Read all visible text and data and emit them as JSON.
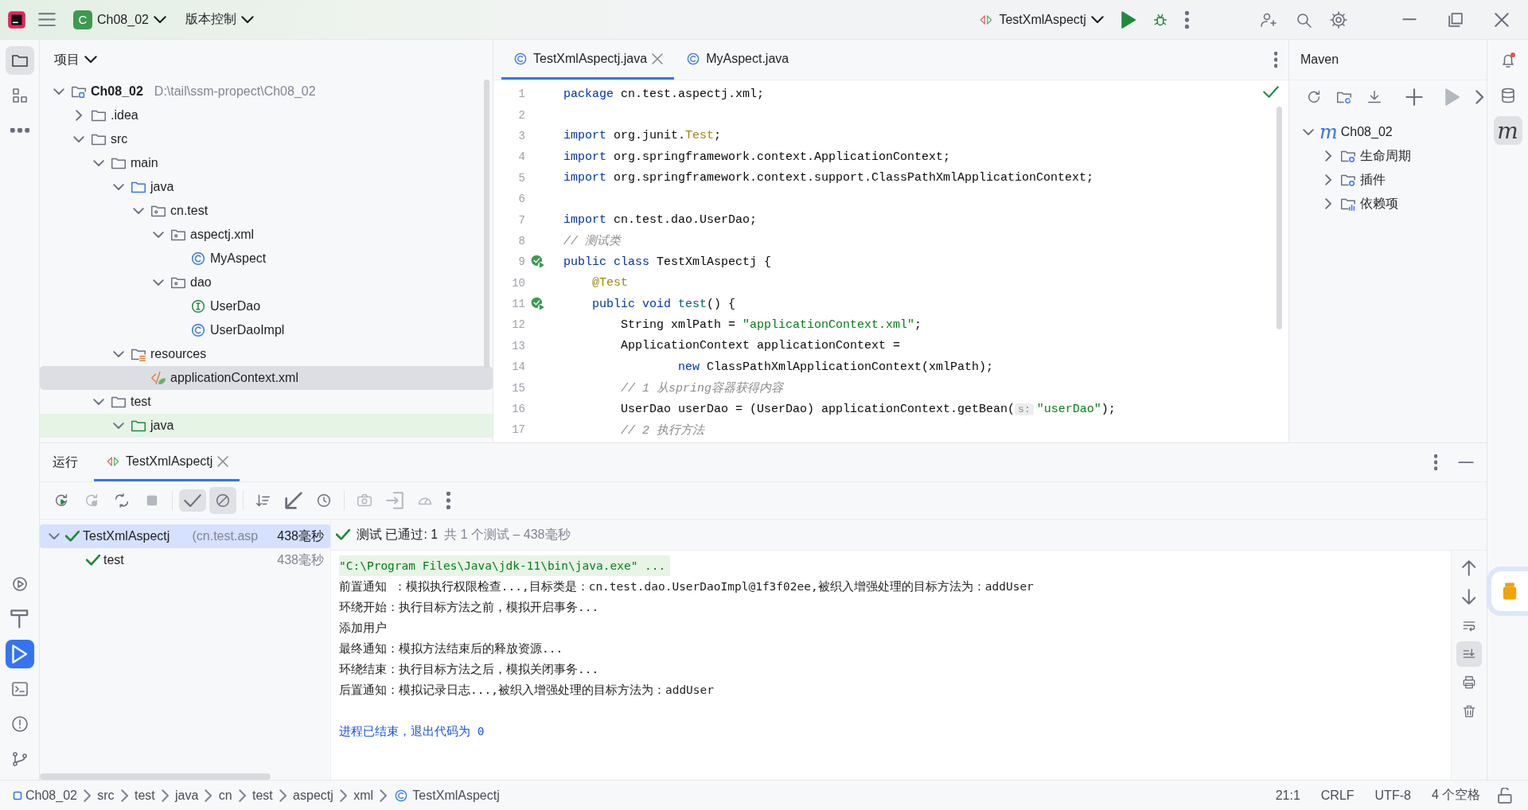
{
  "title_bar": {
    "project_badge": "C",
    "project": "Ch08_02",
    "vcs": "版本控制",
    "run_config": "TestXmlAspectj"
  },
  "left_tools": {
    "top": [
      {
        "kind": "project",
        "selected": true
      },
      {
        "kind": "structure",
        "selected": false
      },
      {
        "kind": "more",
        "selected": false
      }
    ],
    "bottom": [
      {
        "kind": "services",
        "selected": false
      },
      {
        "kind": "build",
        "selected": false
      },
      {
        "kind": "run",
        "selected": true
      },
      {
        "kind": "terminal",
        "selected": false
      },
      {
        "kind": "problems",
        "selected": false
      },
      {
        "kind": "git",
        "selected": false
      }
    ]
  },
  "project_panel": {
    "title": "项目",
    "tree": [
      {
        "label": "Ch08_02",
        "path": "D:\\tail\\ssm-propect\\Ch08_02",
        "kind": "module",
        "expanded": true,
        "selected": false,
        "children": [
          {
            "label": ".idea",
            "kind": "folder",
            "expanded": false,
            "selected": false
          },
          {
            "label": "src",
            "kind": "folder",
            "expanded": true,
            "selected": false,
            "children": [
              {
                "label": "main",
                "kind": "folder",
                "expanded": true,
                "selected": false,
                "children": [
                  {
                    "label": "java",
                    "kind": "source",
                    "expanded": true,
                    "selected": false,
                    "children": [
                      {
                        "label": "cn.test",
                        "kind": "package",
                        "expanded": true,
                        "selected": false,
                        "children": [
                          {
                            "label": "aspectj.xml",
                            "kind": "package",
                            "expanded": true,
                            "selected": false,
                            "children": [
                              {
                                "label": "MyAspect",
                                "kind": "class",
                                "selected": false
                              }
                            ]
                          },
                          {
                            "label": "dao",
                            "kind": "package",
                            "expanded": true,
                            "selected": false,
                            "children": [
                              {
                                "label": "UserDao",
                                "kind": "interface",
                                "selected": false
                              },
                              {
                                "label": "UserDaoImpl",
                                "kind": "class",
                                "selected": false
                              }
                            ]
                          }
                        ]
                      }
                    ]
                  },
                  {
                    "label": "resources",
                    "kind": "resources",
                    "expanded": true,
                    "selected": false,
                    "children": [
                      {
                        "label": "applicationContext.xml",
                        "kind": "xml",
                        "selected": true
                      }
                    ]
                  }
                ]
              },
              {
                "label": "test",
                "kind": "folder",
                "expanded": true,
                "selected": false,
                "children": [
                  {
                    "label": "java",
                    "kind": "test_source",
                    "expanded": true,
                    "selected": false,
                    "highlighted": true
                  }
                ]
              }
            ]
          }
        ]
      }
    ]
  },
  "editor": {
    "tabs": [
      {
        "label": "TestXmlAspectj.java",
        "kind": "class",
        "selected": true
      },
      {
        "label": "MyAspect.java",
        "kind": "class",
        "selected": false
      }
    ],
    "lines": [
      {
        "number": "1",
        "tokens": [
          {
            "kind": "kw",
            "text": "package"
          },
          {
            "kind": "plain",
            "text": " cn.test.aspectj.xml;"
          }
        ]
      },
      {
        "number": "2"
      },
      {
        "number": "3",
        "tokens": [
          {
            "kind": "kw",
            "text": "import"
          },
          {
            "kind": "plain",
            "text": " org.junit."
          },
          {
            "kind": "ann",
            "text": "Test"
          },
          {
            "kind": "plain",
            "text": ";"
          }
        ]
      },
      {
        "number": "4",
        "tokens": [
          {
            "kind": "kw",
            "text": "import"
          },
          {
            "kind": "plain",
            "text": " org.springframework.context.ApplicationContext;"
          }
        ]
      },
      {
        "number": "5",
        "tokens": [
          {
            "kind": "kw",
            "text": "import"
          },
          {
            "kind": "plain",
            "text": " org.springframework.context.support.ClassPathXmlApplicationContext;"
          }
        ]
      },
      {
        "number": "6"
      },
      {
        "number": "7",
        "tokens": [
          {
            "kind": "kw",
            "text": "import"
          },
          {
            "kind": "plain",
            "text": " cn.test.dao.UserDao;"
          }
        ]
      },
      {
        "number": "8",
        "tokens": [
          {
            "kind": "cmt",
            "text": "// 测试类"
          }
        ]
      },
      {
        "number": "9",
        "run_marker": true,
        "tokens": [
          {
            "kind": "kw",
            "text": "public class"
          },
          {
            "kind": "plain",
            "text": " TestXmlAspectj {"
          }
        ]
      },
      {
        "number": "10",
        "tokens": [
          {
            "kind": "ann",
            "text": "    @Test"
          }
        ]
      },
      {
        "number": "11",
        "run_marker": true,
        "tokens": [
          {
            "kind": "kw",
            "text": "    public void "
          },
          {
            "kind": "method",
            "text": "test"
          },
          {
            "kind": "plain",
            "text": "() {"
          }
        ]
      },
      {
        "number": "12",
        "tokens": [
          {
            "kind": "plain",
            "text": "        String xmlPath = "
          },
          {
            "kind": "str",
            "text": "\"applicationContext.xml\""
          },
          {
            "kind": "plain",
            "text": ";"
          }
        ]
      },
      {
        "number": "13",
        "tokens": [
          {
            "kind": "plain",
            "text": "        ApplicationContext applicationContext ="
          }
        ]
      },
      {
        "number": "14",
        "tokens": [
          {
            "kind": "kw",
            "text": "                new"
          },
          {
            "kind": "plain",
            "text": " ClassPathXmlApplicationContext(xmlPath);"
          }
        ]
      },
      {
        "number": "15",
        "tokens": [
          {
            "kind": "cmt",
            "text": "        // 1 从spring容器获得内容"
          }
        ]
      },
      {
        "number": "16",
        "tokens": [
          {
            "kind": "plain",
            "text": "        UserDao userDao = (UserDao) applicationContext.getBean("
          },
          {
            "kind": "hint",
            "text": "s:"
          },
          {
            "kind": "str",
            "text": "\"userDao\""
          },
          {
            "kind": "plain",
            "text": ");"
          }
        ]
      },
      {
        "number": "17",
        "tokens": [
          {
            "kind": "cmt",
            "text": "        // 2 执行方法"
          }
        ]
      }
    ]
  },
  "maven": {
    "title": "Maven",
    "tree": [
      {
        "label": "Ch08_02",
        "icon_text": "m",
        "expanded": true,
        "children": [
          {
            "label": "生命周期",
            "kind": "lifecycle",
            "expanded": false
          },
          {
            "label": "插件",
            "kind": "plugins",
            "expanded": false
          },
          {
            "label": "依赖项",
            "kind": "dependencies",
            "expanded": false
          }
        ]
      }
    ]
  },
  "right_tools": [
    {
      "kind": "notifications",
      "selected": false
    },
    {
      "kind": "database",
      "selected": false
    },
    {
      "icon_text": "m",
      "selected": true
    }
  ],
  "run_panel": {
    "title": "运行",
    "tabs": [
      {
        "label": "TestXmlAspectj",
        "selected": true
      }
    ],
    "toolbar": [
      {
        "kind": "rerun",
        "on": false,
        "disabled": false
      },
      {
        "kind": "rerun_failed",
        "on": false,
        "disabled": true
      },
      {
        "kind": "toggle_auto",
        "on": false,
        "disabled": false
      },
      {
        "kind": "stop",
        "on": false,
        "disabled": true
      },
      {
        "kind": "sep"
      },
      {
        "kind": "show_passed",
        "on": true,
        "disabled": false
      },
      {
        "kind": "show_ignored",
        "on": true,
        "disabled": false
      },
      {
        "kind": "sep"
      },
      {
        "kind": "sort",
        "on": false,
        "disabled": false
      },
      {
        "kind": "collapse",
        "on": false,
        "disabled": false
      },
      {
        "kind": "history",
        "on": false,
        "disabled": false
      },
      {
        "kind": "sep"
      },
      {
        "kind": "camera",
        "on": false,
        "disabled": true
      },
      {
        "kind": "import",
        "on": false,
        "disabled": true
      },
      {
        "kind": "gauge",
        "on": false,
        "disabled": true
      },
      {
        "kind": "more",
        "on": false,
        "disabled": false
      }
    ],
    "tests": [
      {
        "name": "TestXmlAspectj",
        "detail": "(cn.test.asp",
        "duration": "438毫秒",
        "passed": true,
        "expanded": true,
        "selected": true,
        "children": [
          {
            "name": "test",
            "duration": "438毫秒",
            "passed": true,
            "selected": false
          }
        ]
      }
    ],
    "summary": {
      "passed": true,
      "status": "测试 已通过: 1",
      "detail": "共 1 个测试 – 438毫秒"
    },
    "console": [
      {
        "kind": "command",
        "text": "\"C:\\Program Files\\Java\\jdk-11\\bin\\java.exe\" ..."
      },
      {
        "kind": "output",
        "text": "前置通知 ：模拟执行权限检查...,目标类是：cn.test.dao.UserDaoImpl@1f3f02ee,被织入增强处理的目标方法为：addUser"
      },
      {
        "kind": "output",
        "text": "环绕开始：执行目标方法之前，模拟开启事务..."
      },
      {
        "kind": "output",
        "text": "添加用户"
      },
      {
        "kind": "output",
        "text": "最终通知：模拟方法结束后的释放资源..."
      },
      {
        "kind": "output",
        "text": "环绕结束：执行目标方法之后，模拟关闭事务..."
      },
      {
        "kind": "output",
        "text": "后置通知：模拟记录日志...,被织入增强处理的目标方法为：addUser"
      },
      {
        "kind": "blank"
      },
      {
        "kind": "exit",
        "text": "进程已结束，退出代码为 0"
      }
    ],
    "console_tools": [
      {
        "kind": "up",
        "on": false
      },
      {
        "kind": "down",
        "on": false
      },
      {
        "kind": "wrap",
        "on": false
      },
      {
        "kind": "scroll_end",
        "on": true
      },
      {
        "kind": "print",
        "on": false
      },
      {
        "kind": "trash",
        "on": false
      }
    ]
  },
  "status_bar": {
    "breadcrumbs": [
      {
        "label": "Ch08_02",
        "kind": "module"
      },
      {
        "label": "src",
        "kind": "plain"
      },
      {
        "label": "test",
        "kind": "plain"
      },
      {
        "label": "java",
        "kind": "plain"
      },
      {
        "label": "cn",
        "kind": "plain"
      },
      {
        "label": "test",
        "kind": "plain"
      },
      {
        "label": "aspectj",
        "kind": "plain"
      },
      {
        "label": "xml",
        "kind": "plain"
      },
      {
        "label": "TestXmlAspectj",
        "kind": "class"
      }
    ],
    "right": [
      "21:1",
      "CRLF",
      "UTF-8",
      "4 个空格"
    ]
  }
}
